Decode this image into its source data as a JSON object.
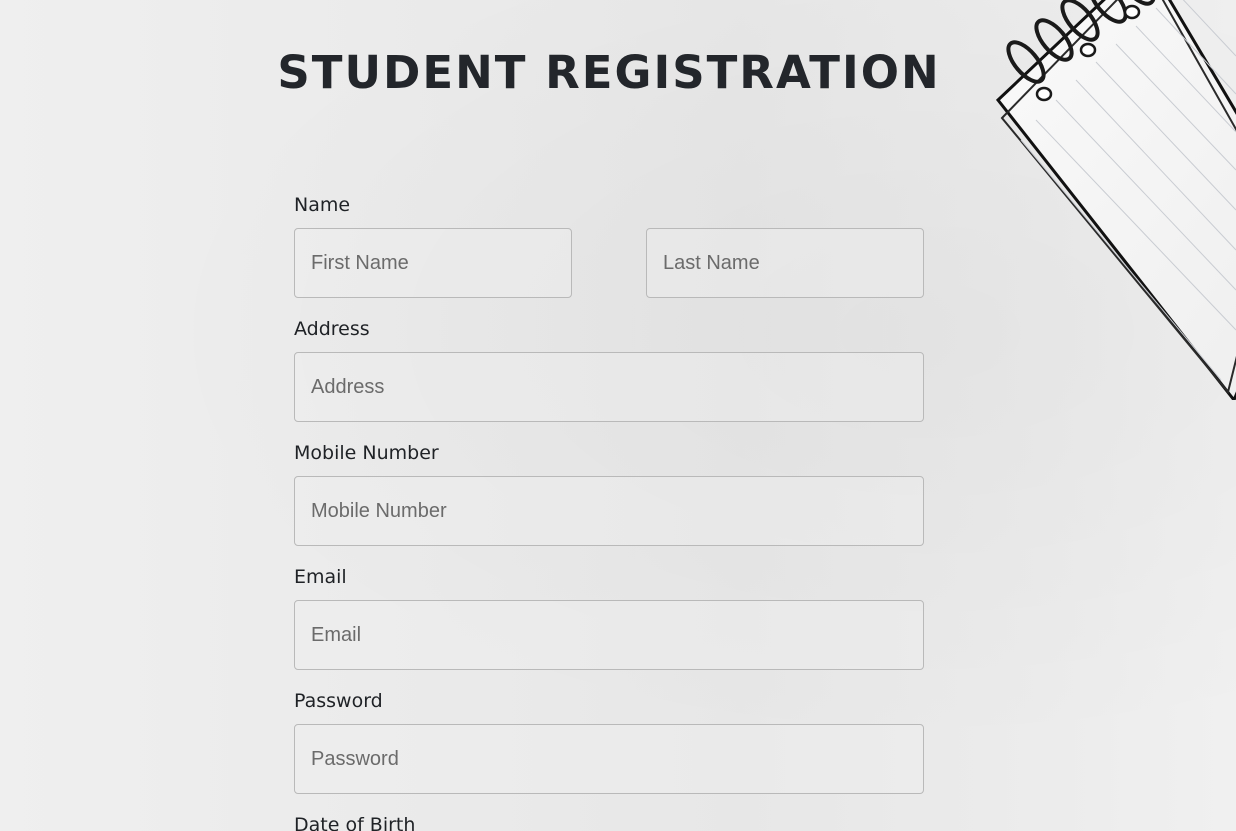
{
  "page": {
    "title": "STUDENT REGISTRATION"
  },
  "form": {
    "name": {
      "label": "Name",
      "first_placeholder": "First Name",
      "last_placeholder": "Last Name"
    },
    "address": {
      "label": "Address",
      "placeholder": "Address"
    },
    "mobile": {
      "label": "Mobile Number",
      "placeholder": "Mobile Number"
    },
    "email": {
      "label": "Email",
      "placeholder": "Email"
    },
    "password": {
      "label": "Password",
      "placeholder": "Password"
    },
    "dob": {
      "label": "Date of Birth"
    }
  },
  "decor": {
    "notebook_icon": "spiral-notebook-image"
  },
  "colors": {
    "title": "#23262b",
    "input_border": "#b9b9b9",
    "background": "#ebebeb"
  }
}
